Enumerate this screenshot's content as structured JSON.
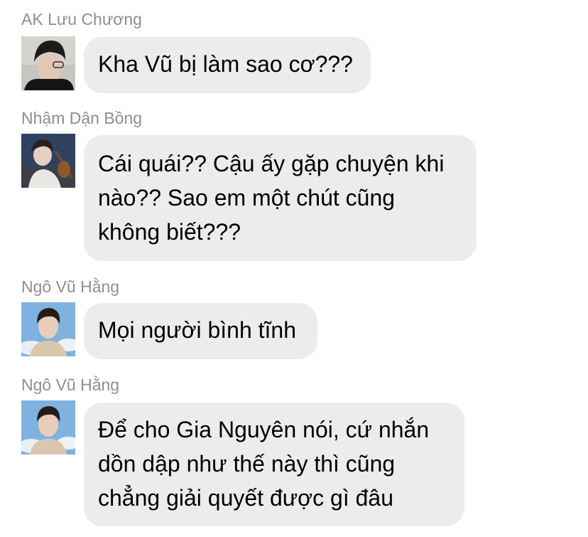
{
  "messages": [
    {
      "sender": "AK Lưu Chương",
      "avatar": "avatar-ak-luu-chuong",
      "lines": [
        "Kha Vũ bị làm sao cơ???"
      ]
    },
    {
      "sender": "Nhậm Dận Bồng",
      "avatar": "avatar-nham-dan-bong",
      "lines": [
        "Cái quái?? Cậu ấy gặp chuyện khi",
        "nào?? Sao em một chút cũng",
        "không biết???"
      ]
    },
    {
      "sender": "Ngô Vũ Hằng",
      "avatar": "avatar-ngo-vu-hang",
      "lines": [
        "Mọi người bình tĩnh"
      ]
    },
    {
      "sender": "Ngô Vũ Hằng",
      "avatar": "avatar-ngo-vu-hang",
      "lines": [
        "Để cho Gia Nguyên nói, cứ nhắn",
        "dồn dập như thế này thì cũng",
        "chẳng giải quyết được gì đâu"
      ]
    }
  ],
  "colors": {
    "bubble": "#ececec",
    "sender_name": "#8e8e93",
    "text": "#000000",
    "background": "#ffffff"
  }
}
